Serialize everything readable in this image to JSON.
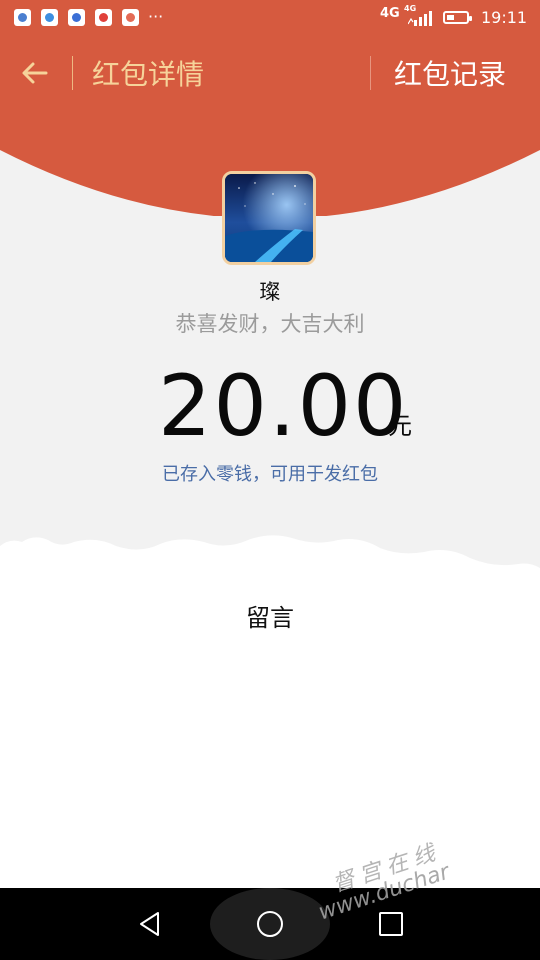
{
  "status_bar": {
    "more_glyph": "···",
    "network": "4G",
    "network_secondary": "4G",
    "battery_level": 0.4,
    "time": "19:11",
    "app_icons": [
      "wifi-signal-icon",
      "chat-bubble-icon",
      "paw-icon",
      "video-play-icon",
      "map-pin-icon"
    ]
  },
  "header": {
    "back_icon": "arrow-left-icon",
    "title": "红包详情",
    "records_button": "红包记录"
  },
  "packet": {
    "sender_name": "璨",
    "greeting": "恭喜发财，大吉大利",
    "amount": "20.00",
    "currency": "元",
    "saved_note": "已存入零钱，可用于发红包"
  },
  "message": {
    "label": "留言"
  },
  "watermark": {
    "line1": "督宫在线",
    "line2": "www.duchar"
  },
  "navbar": {
    "back_icon": "triangle-back-icon",
    "home_icon": "circle-home-icon",
    "recent_icon": "square-recent-icon"
  },
  "colors": {
    "header_red": "#d65a3f",
    "title_gold": "#f6d39a",
    "avatar_border": "#f2d0a1",
    "link_blue": "#4a6da7",
    "page_gray": "#f2f2f2"
  }
}
